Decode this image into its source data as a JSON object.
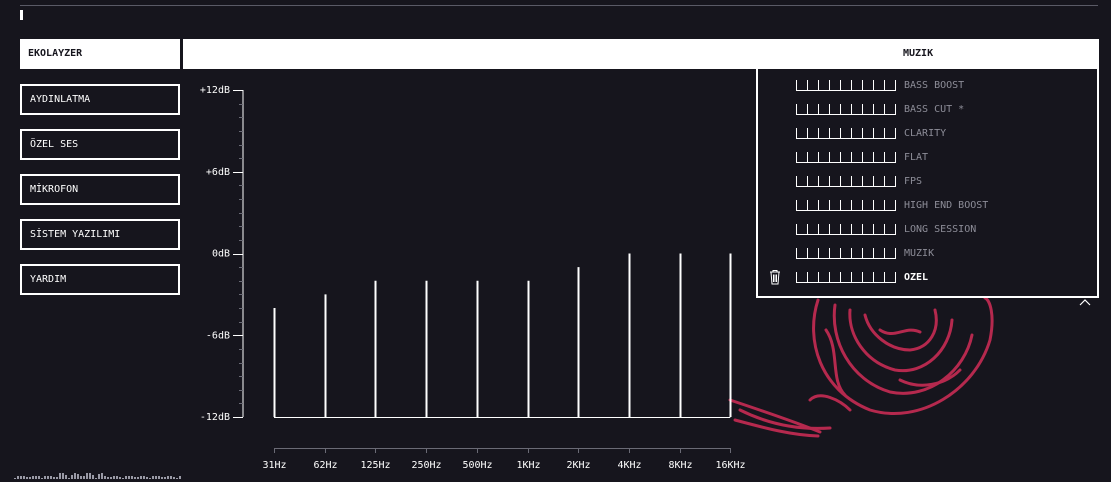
{
  "sidebar": {
    "active_tab": "EKOLAYZER",
    "items": [
      {
        "label": "AYDINLATMA"
      },
      {
        "label": "ÖZEL SES"
      },
      {
        "label": "MİKROFON"
      },
      {
        "label": "SİSTEM YAZILIMI"
      },
      {
        "label": "YARDIM"
      }
    ]
  },
  "preset_selector": {
    "selected": "MUZIK",
    "options": [
      {
        "label": "BASS BOOST",
        "selected": false
      },
      {
        "label": "BASS CUT *",
        "selected": false
      },
      {
        "label": "CLARITY",
        "selected": false
      },
      {
        "label": "FLAT",
        "selected": false
      },
      {
        "label": "FPS",
        "selected": false
      },
      {
        "label": "HIGH END BOOST",
        "selected": false
      },
      {
        "label": "LONG SESSION",
        "selected": false
      },
      {
        "label": "MUZIK",
        "selected": false
      },
      {
        "label": "OZEL",
        "selected": true
      }
    ]
  },
  "colors": {
    "background": "#16151d",
    "foreground": "#ffffff",
    "muted": "#8d8d98",
    "accent_art": "#b5294e"
  },
  "icons": {
    "delete": "trash-icon",
    "collapse": "chevron-up-icon"
  },
  "chart_data": {
    "type": "bar",
    "categories": [
      "31Hz",
      "62Hz",
      "125Hz",
      "250Hz",
      "500Hz",
      "1KHz",
      "2KHz",
      "4KHz",
      "8KHz",
      "16KHz"
    ],
    "values": [
      -4,
      -3,
      -2,
      -2,
      -2,
      -2,
      -1,
      0,
      0,
      0
    ],
    "ylim": [
      -12,
      12
    ],
    "y_ticks": [
      "+12dB",
      "+6dB",
      "0dB",
      "-6dB",
      "-12dB"
    ],
    "y_tick_values": [
      12,
      6,
      0,
      -6,
      -12
    ],
    "title": "",
    "xlabel": "",
    "ylabel": ""
  }
}
